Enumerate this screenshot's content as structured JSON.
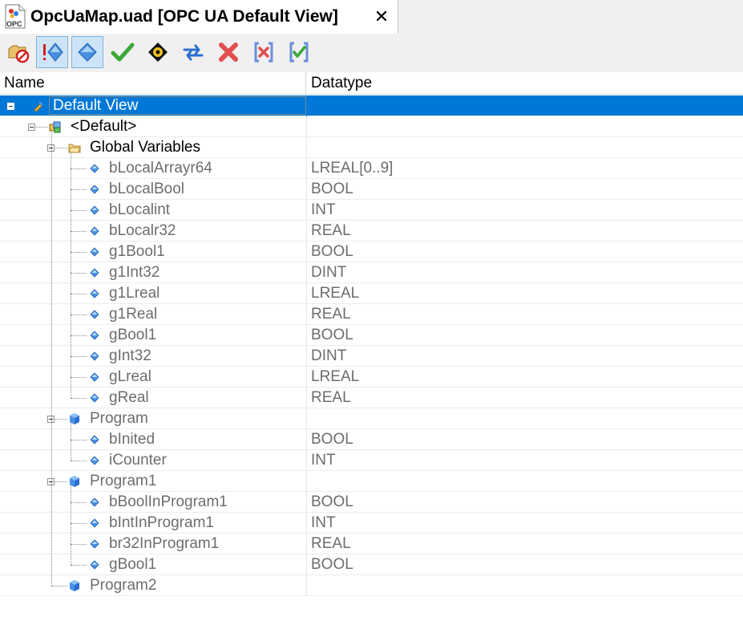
{
  "tab": {
    "title": "OpcUaMap.uad [OPC UA Default View]",
    "icon": "opc-document-icon",
    "close_glyph": "✕"
  },
  "toolbar": {
    "buttons": [
      {
        "name": "disable-icon",
        "pressed": false
      },
      {
        "name": "show-errors-icon",
        "pressed": true
      },
      {
        "name": "diamond-filter-icon",
        "pressed": true
      },
      {
        "name": "check-icon",
        "pressed": false
      },
      {
        "name": "target-icon",
        "pressed": false
      },
      {
        "name": "sync-arrows-icon",
        "pressed": false
      },
      {
        "name": "delete-icon",
        "pressed": false
      },
      {
        "name": "deselect-all-icon",
        "pressed": false
      },
      {
        "name": "select-all-icon",
        "pressed": false
      }
    ]
  },
  "columns": {
    "name": "Name",
    "datatype": "Datatype"
  },
  "tree": [
    {
      "label": "Default View",
      "type": "",
      "level": 0,
      "kind": "view",
      "selected": true
    },
    {
      "label": "<Default>",
      "type": "",
      "level": 1,
      "kind": "default"
    },
    {
      "label": "Global Variables",
      "type": "",
      "level": 2,
      "kind": "folder"
    },
    {
      "label": "bLocalArrayr64",
      "type": "LREAL[0..9]",
      "level": 3,
      "kind": "var"
    },
    {
      "label": "bLocalBool",
      "type": "BOOL",
      "level": 3,
      "kind": "var"
    },
    {
      "label": "bLocalint",
      "type": "INT",
      "level": 3,
      "kind": "var"
    },
    {
      "label": "bLocalr32",
      "type": "REAL",
      "level": 3,
      "kind": "var"
    },
    {
      "label": "g1Bool1",
      "type": "BOOL",
      "level": 3,
      "kind": "var"
    },
    {
      "label": "g1Int32",
      "type": "DINT",
      "level": 3,
      "kind": "var"
    },
    {
      "label": "g1Lreal",
      "type": "LREAL",
      "level": 3,
      "kind": "var"
    },
    {
      "label": "g1Real",
      "type": "REAL",
      "level": 3,
      "kind": "var"
    },
    {
      "label": "gBool1",
      "type": "BOOL",
      "level": 3,
      "kind": "var"
    },
    {
      "label": "gInt32",
      "type": "DINT",
      "level": 3,
      "kind": "var"
    },
    {
      "label": "gLreal",
      "type": "LREAL",
      "level": 3,
      "kind": "var"
    },
    {
      "label": "gReal",
      "type": "REAL",
      "level": 3,
      "kind": "var"
    },
    {
      "label": "Program",
      "type": "",
      "level": 2,
      "kind": "program"
    },
    {
      "label": "bInited",
      "type": "BOOL",
      "level": 3,
      "kind": "var"
    },
    {
      "label": "iCounter",
      "type": "INT",
      "level": 3,
      "kind": "var"
    },
    {
      "label": "Program1",
      "type": "",
      "level": 2,
      "kind": "program"
    },
    {
      "label": "bBoolInProgram1",
      "type": "BOOL",
      "level": 3,
      "kind": "var"
    },
    {
      "label": "bIntInProgram1",
      "type": "INT",
      "level": 3,
      "kind": "var"
    },
    {
      "label": "br32InProgram1",
      "type": "REAL",
      "level": 3,
      "kind": "var"
    },
    {
      "label": "gBool1",
      "type": "BOOL",
      "level": 3,
      "kind": "var"
    },
    {
      "label": "Program2",
      "type": "",
      "level": 2,
      "kind": "program"
    }
  ],
  "colors": {
    "selection": "#0078d7",
    "toolbar_bg": "#f0f0f0",
    "pressed_bg": "#cde3f7"
  }
}
